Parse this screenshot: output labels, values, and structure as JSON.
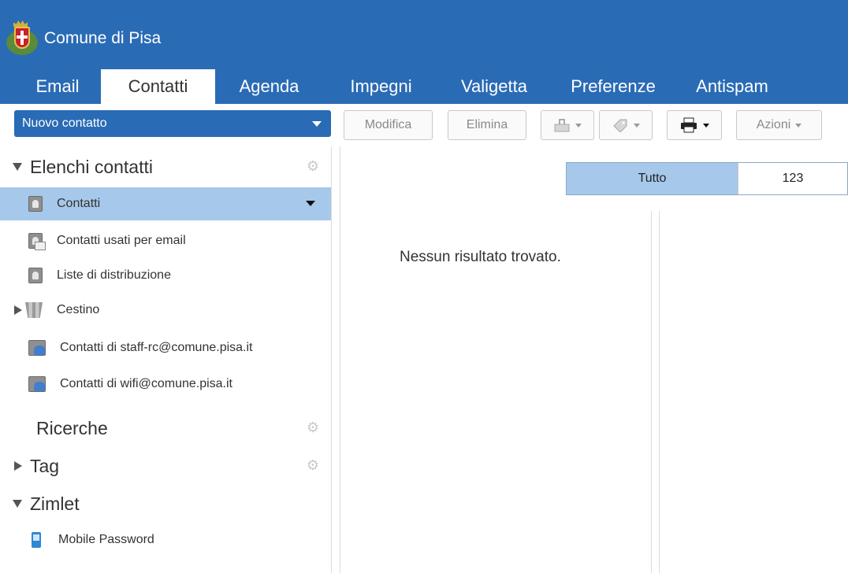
{
  "header": {
    "title": "Comune di Pisa"
  },
  "tabs": [
    {
      "label": "Email"
    },
    {
      "label": "Contatti"
    },
    {
      "label": "Agenda"
    },
    {
      "label": "Impegni"
    },
    {
      "label": "Valigetta"
    },
    {
      "label": "Preferenze"
    },
    {
      "label": "Antispam"
    }
  ],
  "toolbar": {
    "new_contact": "Nuovo contatto",
    "edit": "Modifica",
    "delete": "Elimina",
    "actions": "Azioni"
  },
  "sidebar": {
    "sections": {
      "contact_lists": "Elenchi contatti",
      "searches": "Ricerche",
      "tags": "Tag",
      "zimlets": "Zimlet"
    },
    "items": [
      {
        "label": "Contatti"
      },
      {
        "label": "Contatti usati per email"
      },
      {
        "label": "Liste di distribuzione"
      },
      {
        "label": "Cestino"
      },
      {
        "label": "Contatti di staff-rc@comune.pisa.it"
      },
      {
        "label": "Contatti di wifi@comune.pisa.it"
      }
    ],
    "zimlet_items": [
      {
        "label": "Mobile Password"
      }
    ]
  },
  "filter": {
    "all": "Tutto",
    "digits": "123"
  },
  "list": {
    "empty_message": "Nessun risultato trovato."
  },
  "colors": {
    "brand": "#2a6bb5",
    "selection": "#a6c8ea"
  }
}
